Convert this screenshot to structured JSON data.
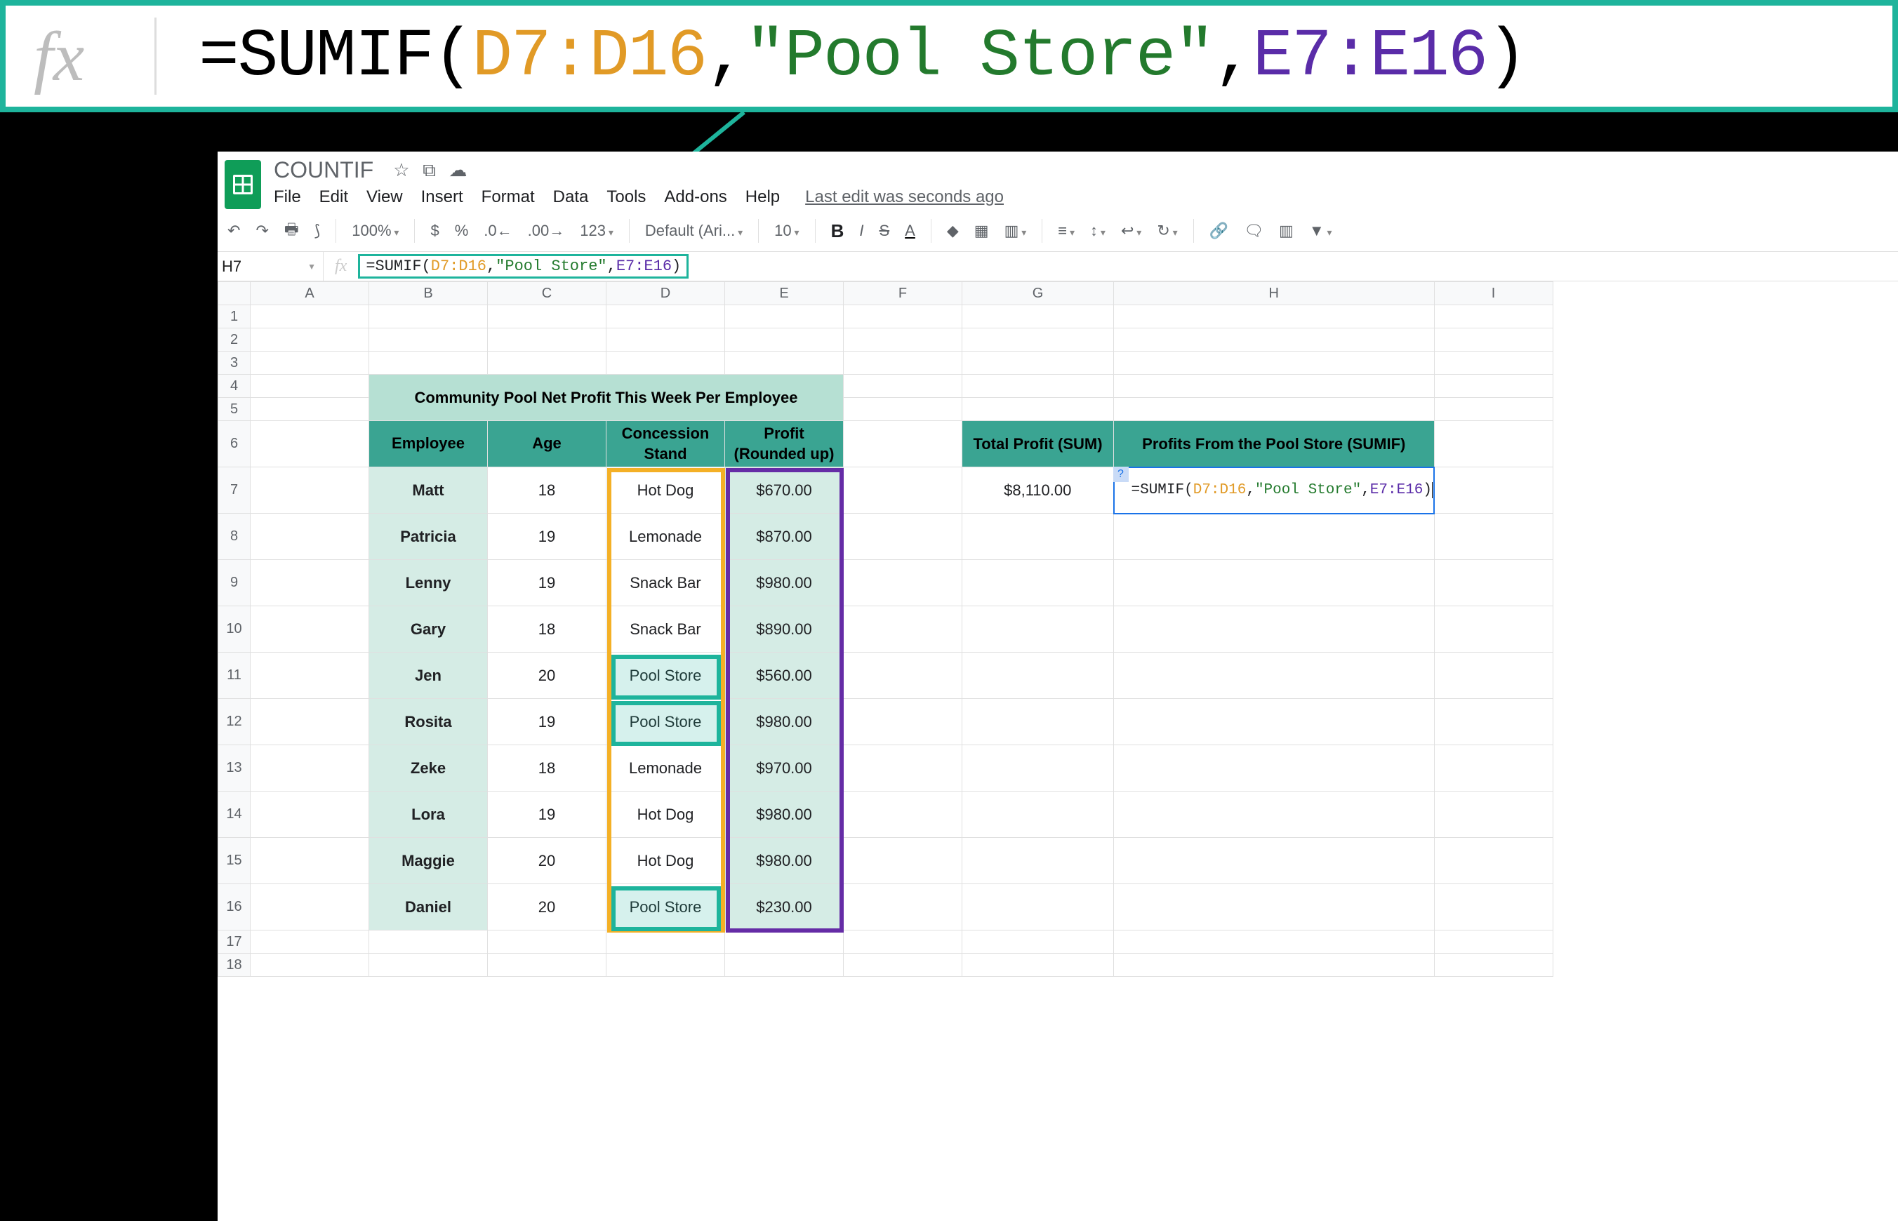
{
  "callout": {
    "eq": "=SUMIF(",
    "range1": "D7:D16",
    "sep1": ",",
    "crit": "\"Pool Store\"",
    "sep2": ",",
    "range2": "E7:E16",
    "close": ")"
  },
  "header": {
    "doc_title": "COUNTIF",
    "star": "☆",
    "move": "⧉",
    "cloud": "☁",
    "menu": {
      "file": "File",
      "edit": "Edit",
      "view": "View",
      "insert": "Insert",
      "format": "Format",
      "data": "Data",
      "tools": "Tools",
      "addons": "Add-ons",
      "help": "Help"
    },
    "last_edit": "Last edit was seconds ago"
  },
  "toolbar": {
    "undo": "↶",
    "redo": "↷",
    "print": "🖶",
    "paint": "⟆",
    "zoom": "100%",
    "currency": "$",
    "percent": "%",
    "dec_dec": ".0←",
    "dec_inc": ".00→",
    "numfmt": "123",
    "font": "Default (Ari...",
    "size": "10",
    "bold": "B",
    "italic": "I",
    "strike": "S",
    "text_color": "A",
    "fill": "◆",
    "borders": "▦",
    "merge": "▥",
    "halign": "≡",
    "valign": "↕",
    "wrap": "↩",
    "rotate": "↻",
    "link": "🔗",
    "comment": "🗨",
    "chart": "▥",
    "filter": "▼"
  },
  "fxbar": {
    "cell_ref": "H7",
    "eq": "=SUMIF(",
    "r1": "D7:D16",
    "s1": ",",
    "crit": "\"Pool Store\"",
    "s2": ",",
    "r2": "E7:E16",
    "close": ")"
  },
  "columns": {
    "A": "A",
    "B": "B",
    "C": "C",
    "D": "D",
    "E": "E",
    "F": "F",
    "G": "G",
    "H": "H",
    "I": "I"
  },
  "rows": {
    "1": "1",
    "2": "2",
    "3": "3",
    "4": "4",
    "5": "5",
    "6": "6",
    "7": "7",
    "8": "8",
    "9": "9",
    "10": "10",
    "11": "11",
    "12": "12",
    "13": "13",
    "14": "14",
    "15": "15",
    "16": "16",
    "17": "17",
    "18": "18"
  },
  "table_title": "Community Pool Net Profit This Week Per Employee",
  "table_headers": {
    "emp": "Employee",
    "age": "Age",
    "conc": "Concession Stand",
    "profit": "Profit (Rounded up)"
  },
  "employees": [
    {
      "name": "Matt",
      "age": "18",
      "conc": "Hot Dog",
      "profit": "$670.00"
    },
    {
      "name": "Patricia",
      "age": "19",
      "conc": "Lemonade",
      "profit": "$870.00"
    },
    {
      "name": "Lenny",
      "age": "19",
      "conc": "Snack Bar",
      "profit": "$980.00"
    },
    {
      "name": "Gary",
      "age": "18",
      "conc": "Snack Bar",
      "profit": "$890.00"
    },
    {
      "name": "Jen",
      "age": "20",
      "conc": "Pool Store",
      "profit": "$560.00"
    },
    {
      "name": "Rosita",
      "age": "19",
      "conc": "Pool Store",
      "profit": "$980.00"
    },
    {
      "name": "Zeke",
      "age": "18",
      "conc": "Lemonade",
      "profit": "$970.00"
    },
    {
      "name": "Lora",
      "age": "19",
      "conc": "Hot Dog",
      "profit": "$980.00"
    },
    {
      "name": "Maggie",
      "age": "20",
      "conc": "Hot Dog",
      "profit": "$980.00"
    },
    {
      "name": "Daniel",
      "age": "20",
      "conc": "Pool Store",
      "profit": "$230.00"
    }
  ],
  "side": {
    "sum_hdr": "Total Profit (SUM)",
    "sumif_hdr": "Profits From the Pool Store (SUMIF)",
    "sum_val": "$8,110.00"
  },
  "cell_edit": {
    "q": "?",
    "eq": "=SUMIF(",
    "r1": "D7:D16",
    "s1": ",",
    "crit": "\"Pool Store\"",
    "s2": ",",
    "r2": "E7:E16",
    "close": ")"
  }
}
